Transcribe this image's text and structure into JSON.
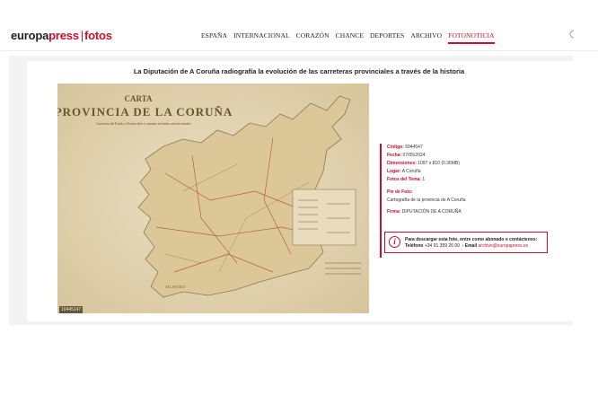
{
  "logo": {
    "europa": "europa",
    "press": "press",
    "sep": "|",
    "fotos": "fotos"
  },
  "nav": [
    {
      "label": "ESPAÑA",
      "active": false
    },
    {
      "label": "INTERNACIONAL",
      "active": false
    },
    {
      "label": "CORAZÓN",
      "active": false
    },
    {
      "label": "CHANCE",
      "active": false
    },
    {
      "label": "DEPORTES",
      "active": false
    },
    {
      "label": "ARCHIVO",
      "active": false
    },
    {
      "label": "FOTONOTICIA",
      "active": true
    }
  ],
  "article": {
    "title": "La Diputación de A Coruña radiografía la evolución de las carreteras provinciales a través de la historia"
  },
  "photo": {
    "code": "10445147",
    "map_title_small": "CARTA",
    "map_title_main": "PROVINCIA DE LA CORUÑA",
    "map_subtitle": "Carreteras del Estado y Provinciales y caminos vecinales subvencionados"
  },
  "info": {
    "codigo_label": "Código:",
    "codigo_value": "5944547",
    "fecha_label": "Fecha:",
    "fecha_value": "07/05/2024",
    "dimensiones_label": "Dimensiones:",
    "dimensiones_value": "1097 x 810 (0.36MB)",
    "lugar_label": "Lugar:",
    "lugar_value": "A Coruña",
    "fotos_label": "Fotos del Tema:",
    "fotos_value": "1",
    "pie_label": "Pie de Foto:",
    "pie_value": "Cartografía de la provincia de A Coruña",
    "firma_label": "Firma:",
    "firma_value": "DIPUTACIÓN DE A CORUÑA"
  },
  "download": {
    "line1": "Para descargar esta foto, entre como abonado o contáctenos:",
    "tel_label": "Teléfono",
    "tel_value": "+34 91 359 26 00",
    "email_label": "Email",
    "email_value": "archivo@europapress.es"
  },
  "colors": {
    "accent": "#c8102e",
    "map_paper": "#e6d9b7",
    "map_land": "#d9c596"
  }
}
